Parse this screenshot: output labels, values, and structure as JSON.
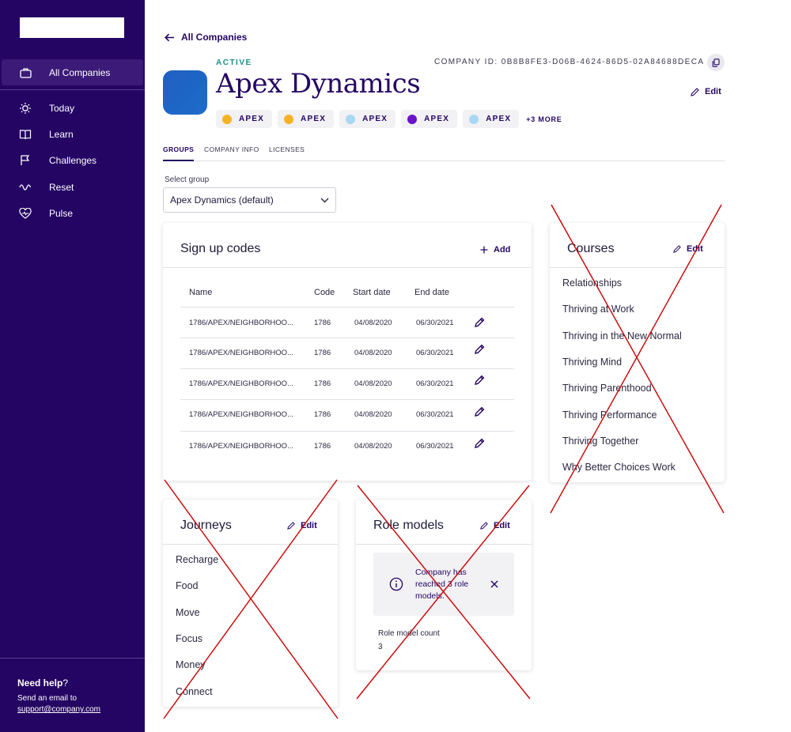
{
  "sidebar": {
    "items": [
      {
        "label": "All Companies",
        "icon": "briefcase-icon",
        "active": true
      },
      {
        "label": "Today",
        "icon": "sun-icon"
      },
      {
        "label": "Learn",
        "icon": "book-icon"
      },
      {
        "label": "Challenges",
        "icon": "flag-icon"
      },
      {
        "label": "Reset",
        "icon": "wave-icon"
      },
      {
        "label": "Pulse",
        "icon": "heart-pulse-icon"
      }
    ],
    "help": {
      "title": "Need help",
      "title_mark": "?",
      "text": "Send an email to",
      "email": "support@company.com"
    }
  },
  "header": {
    "back_label": "All Companies",
    "status": "ACTIVE",
    "company_name": "Apex Dynamics",
    "company_id": "COMPANY ID: 0B8B8FE3-D06B-4624-86D5-02A84688DECA",
    "edit_label": "Edit",
    "tags": [
      {
        "label": "APEX",
        "color": "#f5b324"
      },
      {
        "label": "APEX",
        "color": "#f5b324"
      },
      {
        "label": "APEX",
        "color": "#a9d8f2"
      },
      {
        "label": "APEX",
        "color": "#6a12c9"
      },
      {
        "label": "APEX",
        "color": "#a9d8f2"
      }
    ],
    "more_tags": "+3 MORE"
  },
  "tabs": [
    "GROUPS",
    "COMPANY INFO",
    "LICENSES"
  ],
  "group_select": {
    "label": "Select group",
    "value": "Apex Dynamics (default)"
  },
  "signup_codes": {
    "title": "Sign up codes",
    "add_label": "Add",
    "columns": [
      "Name",
      "Code",
      "Start date",
      "End date"
    ],
    "rows": [
      {
        "name": "1786/APEX/NEIGHBORHOO...",
        "code": "1786",
        "start": "04/08/2020",
        "end": "06/30/2021"
      },
      {
        "name": "1786/APEX/NEIGHBORHOO...",
        "code": "1786",
        "start": "04/08/2020",
        "end": "06/30/2021"
      },
      {
        "name": "1786/APEX/NEIGHBORHOO...",
        "code": "1786",
        "start": "04/08/2020",
        "end": "06/30/2021"
      },
      {
        "name": "1786/APEX/NEIGHBORHOO...",
        "code": "1786",
        "start": "04/08/2020",
        "end": "06/30/2021"
      },
      {
        "name": "1786/APEX/NEIGHBORHOO...",
        "code": "1786",
        "start": "04/08/2020",
        "end": "06/30/2021"
      }
    ]
  },
  "courses": {
    "title": "Courses",
    "edit_label": "Edit",
    "items": [
      "Relationships",
      "Thriving at Work",
      "Thriving in the New Normal",
      "Thriving Mind",
      "Thriving Parenthood",
      "Thriving Performance",
      "Thriving Together",
      "Why Better Choices Work"
    ]
  },
  "journeys": {
    "title": "Journeys",
    "edit_label": "Edit",
    "items": [
      "Recharge",
      "Food",
      "Move",
      "Focus",
      "Money",
      "Connect"
    ]
  },
  "role_models": {
    "title": "Role models",
    "edit_label": "Edit",
    "banner": "Company has reached 3 role models.",
    "count_label": "Role model count",
    "count_value": "3"
  },
  "colors": {
    "sidebar": "#240563",
    "accent": "#240563",
    "active_status": "#1a8f87",
    "cross_out": "#cc0000"
  }
}
